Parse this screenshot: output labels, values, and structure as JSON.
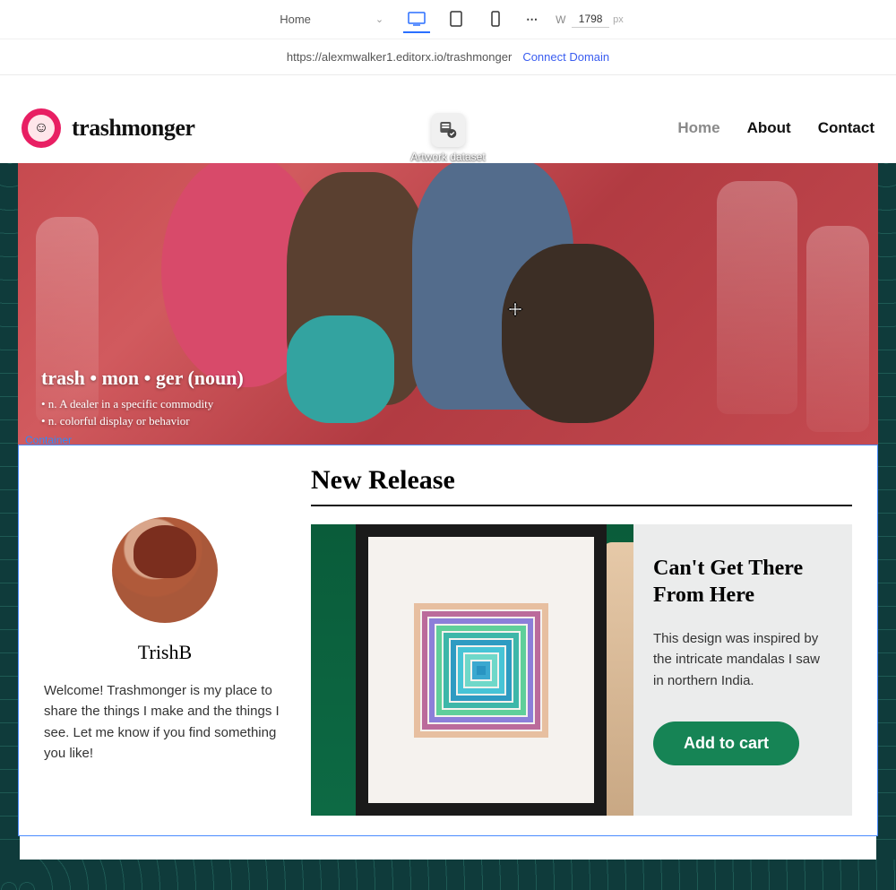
{
  "toolbar": {
    "page_name": "Home",
    "width_label": "W",
    "width_value": "1798",
    "width_unit": "px"
  },
  "urlbar": {
    "url": "https://alexmwalker1.editorx.io/trashmonger",
    "connect_label": "Connect Domain"
  },
  "dataset": {
    "label": "Artwork dataset"
  },
  "site": {
    "name": "trashmonger",
    "nav": {
      "home": "Home",
      "about": "About",
      "contact": "Contact"
    }
  },
  "hero": {
    "title": "trash • mon • ger (noun)",
    "line1": "• n. A dealer in a specific commodity",
    "line2": "• n. colorful display or behavior"
  },
  "selection": {
    "label": "Container"
  },
  "author": {
    "name": "TrishB",
    "bio": "Welcome! Trashmonger is my place to share the things I make and the things I see. Let me know if you find something you like!"
  },
  "release": {
    "heading": "New Release",
    "title": "Can't Get There From Here",
    "description": "This design was inspired by the intricate mandalas I saw in northern India.",
    "cta": "Add to cart"
  }
}
